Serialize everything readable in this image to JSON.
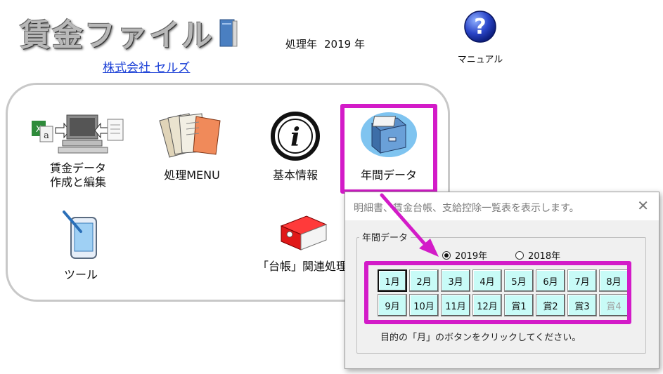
{
  "app": {
    "title": "賃金ファイル",
    "company": "株式会社  セルズ",
    "year_label": "処理年",
    "year_value": "2019 年"
  },
  "help": {
    "label": "マニュアル"
  },
  "menu": {
    "wage": {
      "line1": "賃金データ",
      "line2": "作成と編集"
    },
    "processing": "処理MENU",
    "basic_info": "基本情報",
    "annual_data": "年間データ",
    "tools": "ツール",
    "ledger": "「台帳」関連処理"
  },
  "dialog": {
    "title": "明細書、賃金台帳、支給控除一覧表を表示します。",
    "close_glyph": "✕",
    "group_label": "年間データ",
    "year_options": [
      {
        "label": "2019年",
        "checked": true
      },
      {
        "label": "2018年",
        "checked": false
      }
    ],
    "months": [
      "1月",
      "2月",
      "3月",
      "4月",
      "5月",
      "6月",
      "7月",
      "8月",
      "9月",
      "10月",
      "11月",
      "12月",
      "賞1",
      "賞2",
      "賞3",
      "賞4"
    ],
    "selected_month": "1月",
    "disabled_months": [
      "賞4"
    ],
    "instruction": "目的の「月」のボタンをクリックしてください。"
  },
  "colors": {
    "highlight": "#d31bc8",
    "month_button": "#c8fbf7",
    "link": "#1a3fd6"
  }
}
